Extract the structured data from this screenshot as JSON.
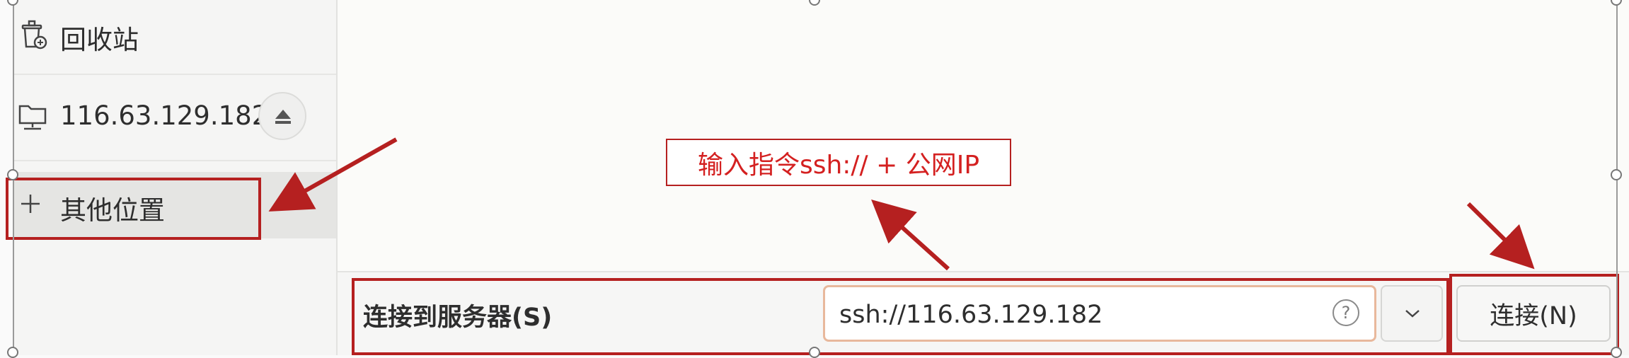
{
  "sidebar": {
    "trash_label": "回收站",
    "server_label": "116.63.129.182",
    "other_locations_label": "其他位置"
  },
  "connect_bar": {
    "label": "连接到服务器(S)",
    "url_value": "ssh://116.63.129.182",
    "connect_button": "连接(N)"
  },
  "annotation": {
    "callout_text": "输入指令ssh:// + 公网IP",
    "color": "#b52020"
  },
  "icons": [
    "trash-icon",
    "network-drive-icon",
    "eject-icon",
    "plus-icon",
    "help-icon",
    "chevron-down-icon"
  ]
}
